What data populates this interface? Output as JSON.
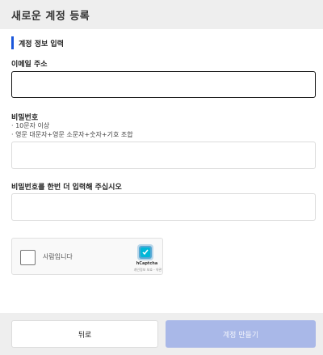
{
  "header": {
    "title": "새로운 계정 등록"
  },
  "section": {
    "title": "계정 정보 입력"
  },
  "email": {
    "label": "이메일 주소",
    "value": "",
    "placeholder": ""
  },
  "password": {
    "label": "비밀번호",
    "hints": [
      "· 10문자 이상",
      "· 영문 대문자+영문 소문자+숫자+기호 조합"
    ],
    "value": "",
    "placeholder": ""
  },
  "password_confirm": {
    "label": "비밀번호를 한번 더 입력해 주십시오",
    "value": "",
    "placeholder": ""
  },
  "captcha": {
    "label": "사람입니다",
    "brand": "hCaptcha",
    "terms": "개인정보 보호 - 약관"
  },
  "footer": {
    "back_label": "뒤로",
    "create_label": "계정 만들기"
  },
  "colors": {
    "accent": "#1a56db",
    "create_button": "#a9b8e8",
    "header_bg": "#eeeeee"
  },
  "icons": {
    "captcha_logo": "hcaptcha-logo-icon"
  }
}
